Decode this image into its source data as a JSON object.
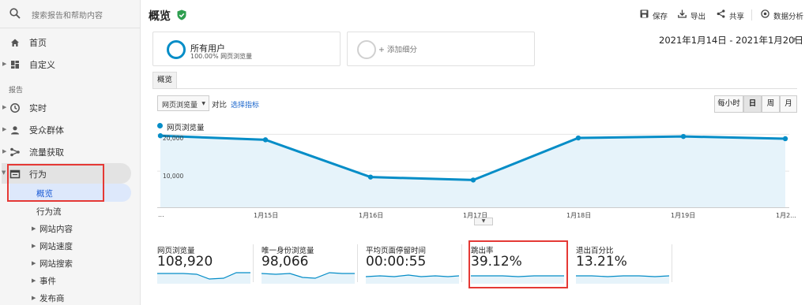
{
  "sidebar": {
    "search_placeholder": "搜索报告和帮助内容",
    "home": "首页",
    "customization": "自定义",
    "section_reports": "报告",
    "realtime": "实时",
    "audience": "受众群体",
    "acquisition": "流量获取",
    "behavior": "行为",
    "behavior_sub": {
      "overview": "概览",
      "behavior_flow": "行为流",
      "site_content": "网站内容",
      "site_speed": "网站速度",
      "site_search": "网站搜索",
      "events": "事件",
      "publisher": "发布商"
    }
  },
  "header": {
    "title": "概览",
    "save": "保存",
    "export": "导出",
    "share": "共享",
    "insights": "数据分析"
  },
  "segments": {
    "all_users_title": "所有用户",
    "all_users_sub": "100.00% 网页浏览量",
    "add_segment": "+ 添加细分"
  },
  "date_range": "2021年1月14日 - 2021年1月20日",
  "tab_overview": "概览",
  "controls": {
    "metric_select": "网页浏览量",
    "compare_label": "对比",
    "select_metric": "选择指标",
    "periods": [
      "每小时",
      "日",
      "周",
      "月"
    ],
    "active_period": "日"
  },
  "colors": {
    "accent": "#058dc7",
    "area_fill": "#e6f3fa",
    "highlight": "#e53935",
    "selected_nav": "#dde8fb"
  },
  "chart_data": {
    "type": "line",
    "legend": "网页浏览量",
    "x": [
      "...",
      "1月15日",
      "1月16日",
      "1月17日",
      "1月18日",
      "1月19日",
      "1月2..."
    ],
    "yticks": [
      "20,000",
      "10,000"
    ],
    "ylim": [
      0,
      20500
    ],
    "series": [
      {
        "name": "网页浏览量",
        "values": [
          19600,
          18500,
          8400,
          7600,
          19000,
          19400,
          18800
        ]
      }
    ]
  },
  "metrics": [
    {
      "label": "网页浏览量",
      "value": "108,920"
    },
    {
      "label": "唯一身份浏览量",
      "value": "98,066"
    },
    {
      "label": "平均页面停留时间",
      "value": "00:00:55"
    },
    {
      "label": "跳出率",
      "value": "39.12%"
    },
    {
      "label": "退出百分比",
      "value": "13.21%"
    }
  ]
}
